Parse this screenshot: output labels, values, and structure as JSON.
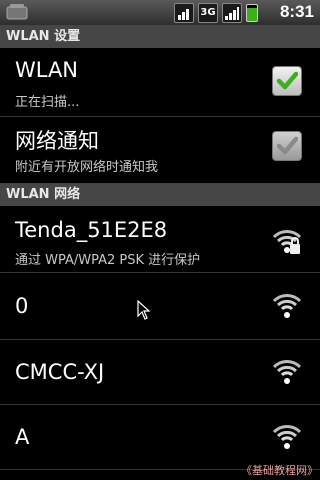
{
  "status_bar": {
    "network_type": "3G",
    "time": "8:31"
  },
  "header": {
    "title": "WLAN 设置"
  },
  "settings": [
    {
      "title": "WLAN",
      "subtitle": "正在扫描...",
      "checked": true,
      "enabled": true
    },
    {
      "title": "网络通知",
      "subtitle": "附近有开放网络时通知我",
      "checked": true,
      "enabled": false
    }
  ],
  "networks_header": {
    "title": "WLAN 网络"
  },
  "networks": [
    {
      "ssid": "Tenda_51E2E8",
      "security": "通过 WPA/WPA2 PSK 进行保护",
      "locked": true
    },
    {
      "ssid": "0",
      "security": "",
      "locked": false
    },
    {
      "ssid": "CMCC-XJ",
      "security": "",
      "locked": false
    },
    {
      "ssid": "A",
      "security": "",
      "locked": false
    }
  ],
  "watermark": "《基础教程网》",
  "colors": {
    "check_green": "#3fae1c",
    "section_bg": "#464646"
  }
}
